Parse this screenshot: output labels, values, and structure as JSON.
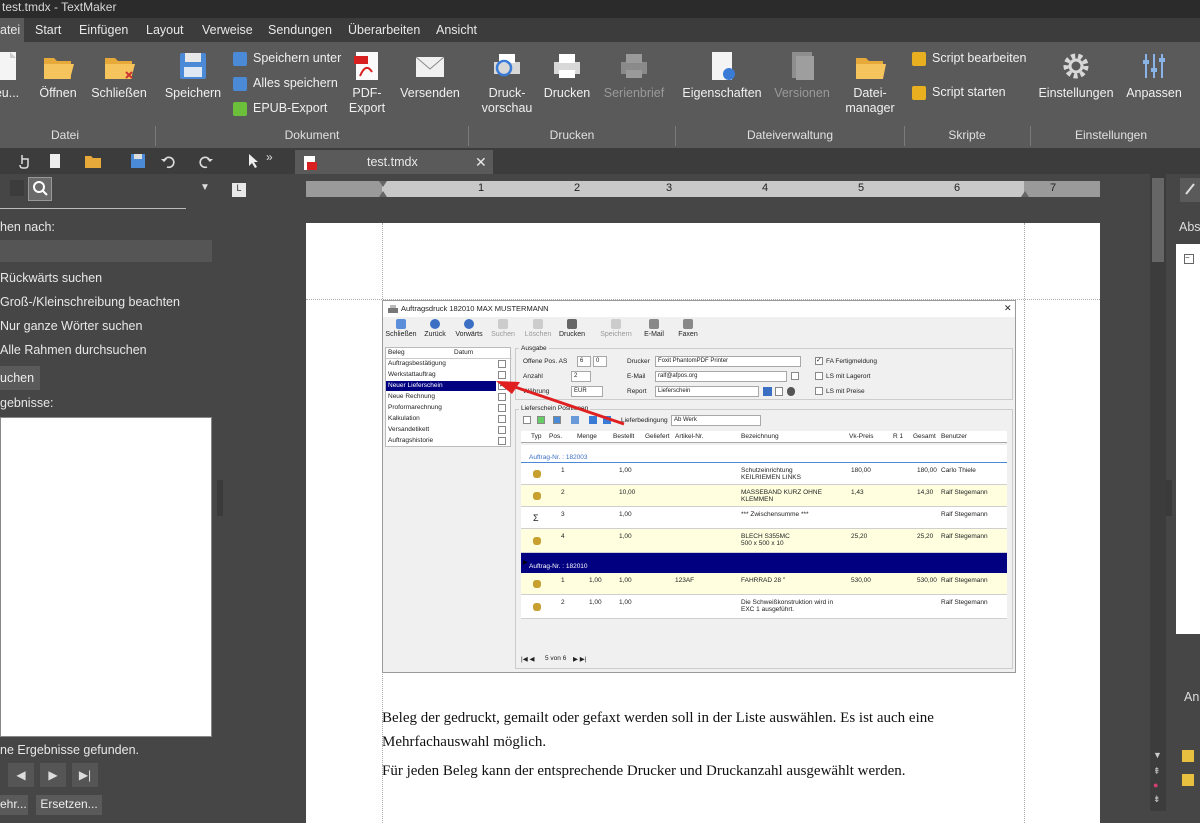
{
  "window": {
    "title": "test.tmdx - TextMaker"
  },
  "menu": {
    "tabs": [
      "atei",
      "Start",
      "Einfügen",
      "Layout",
      "Verweise",
      "Sendungen",
      "Überarbeiten",
      "Ansicht"
    ],
    "active": "atei"
  },
  "ribbon": {
    "buttons": {
      "neu": "eu...",
      "oeffnen": "Öffnen",
      "schliessen": "Schließen",
      "speichern": "Speichern",
      "speichern_unter": "Speichern unter",
      "alles_speichern": "Alles speichern",
      "epub": "EPUB-Export",
      "pdf_line1": "PDF-",
      "pdf_line2": "Export",
      "versenden": "Versenden",
      "druckvorschau_line1": "Druck-",
      "druckvorschau_line2": "vorschau",
      "drucken": "Drucken",
      "serienbrief": "Serienbrief",
      "eigenschaften": "Eigenschaften",
      "versionen": "Versionen",
      "dateimanager_line1": "Datei-",
      "dateimanager_line2": "manager",
      "script_bearbeiten": "Script bearbeiten",
      "script_starten": "Script starten",
      "einstellungen": "Einstellungen",
      "anpassen": "Anpassen"
    },
    "groups": {
      "datei": "Datei",
      "dokument": "Dokument",
      "drucken": "Drucken",
      "dateiverwaltung": "Dateiverwaltung",
      "skripte": "Skripte",
      "einstellungen": "Einstellungen"
    }
  },
  "doc_tab": {
    "label": "test.tmdx"
  },
  "search_panel": {
    "search_for": "hen nach:",
    "options": [
      "Rückwärts suchen",
      "Groß-/Kleinschreibung beachten",
      "Nur ganze Wörter suchen",
      "Alle Rahmen durchsuchen"
    ],
    "search_button": "uchen",
    "results_label": "gebnisse:",
    "no_results": "ne Ergebnisse gefunden.",
    "more_button": "ehr...",
    "replace_button": "Ersetzen..."
  },
  "right_panel": {
    "label1": "Abs",
    "label2": "An"
  },
  "ruler": {
    "numbers": [
      "1",
      "2",
      "3",
      "4",
      "5",
      "6",
      "7"
    ]
  },
  "document": {
    "para1_line1": "Beleg der gedruckt, gemailt oder gefaxt werden soll in der Liste auswählen. Es ist auch eine",
    "para1_line2": "Mehrfachauswahl möglich.",
    "para2": "Für jeden Beleg kann der entsprechende Drucker und Druckanzahl ausgewählt werden."
  },
  "embedded": {
    "title": "Auftragsdruck 182010 MAX MUSTERMANN",
    "toolbar": [
      "Schließen",
      "Zurück",
      "Vorwärts",
      "Suchen",
      "Löschen",
      "Drucken",
      "Speichern",
      "E-Mail",
      "Faxen"
    ],
    "list_headers": [
      "Beleg",
      "Datum"
    ],
    "list_items": [
      "Auftragsbestätigung",
      "Werkstattauftrag",
      "Neuer Lieferschein",
      "Neue Rechnung",
      "Proformarechnung",
      "Kalkulation",
      "Versandetikett",
      "Auftragshistorie"
    ],
    "ausgabe_label": "Ausgabe",
    "offene_pos_label": "Offene Pos. AS",
    "offene_pos_val1": "6",
    "offene_pos_val2": "0",
    "anzahl_label": "Anzahl",
    "anzahl_val": "2",
    "waehrung_label": "Währung",
    "waehrung_val": "EUR",
    "drucker_label": "Drucker",
    "drucker_val": "Foxit PhantomPDF Printer",
    "email_label": "E-Mail",
    "email_val": "ralf@afpos.org",
    "report_label": "Report",
    "report_val": "Lieferschein",
    "fa_label": "FA Fertigmeldung",
    "ls_lager_label": "LS mit Lagerort",
    "ls_preise_label": "LS mit Preise",
    "positionen_label": "Lieferschein Positionen",
    "lieferbedingung_label": "Lieferbedingung",
    "lieferbedingung_val": "Ab Werk",
    "table_headers": [
      "Typ",
      "Pos.",
      "Menge",
      "Bestellt",
      "Geliefert",
      "Artikel-Nr.",
      "Bezeichnung",
      "Vk-Preis",
      "R 1",
      "Gesamt",
      "Benutzer"
    ],
    "group1": "Auftrag-Nr. : 182003",
    "group2": "Auftrag-Nr. : 182010",
    "rows1": [
      {
        "pos": "1",
        "menge": "",
        "bestellt": "1,00",
        "artikel": "",
        "bez1": "Schutzeinrichtung",
        "bez2": "KEILRIEMEN LINKS",
        "vk": "180,00",
        "gesamt": "180,00",
        "user": "Carlo Thiele"
      },
      {
        "pos": "2",
        "menge": "",
        "bestellt": "10,00",
        "artikel": "",
        "bez1": "MASSEBAND KURZ OHNE",
        "bez2": "KLEMMEN",
        "vk": "1,43",
        "gesamt": "14,30",
        "user": "Ralf Stegemann"
      },
      {
        "pos": "3",
        "menge": "",
        "bestellt": "1,00",
        "artikel": "",
        "bez1": "*** Zwischensumme ***",
        "bez2": "",
        "vk": "",
        "gesamt": "",
        "user": "Ralf Stegemann"
      },
      {
        "pos": "4",
        "menge": "",
        "bestellt": "1,00",
        "artikel": "",
        "bez1": "BLECH  S355MC",
        "bez2": "500 x 500 x 10",
        "vk": "25,20",
        "gesamt": "25,20",
        "user": "Ralf Stegemann"
      }
    ],
    "rows2": [
      {
        "pos": "1",
        "menge": "1,00",
        "bestellt": "1,00",
        "artikel": "123AF",
        "bez1": "FAHRRAD 28 \"",
        "bez2": "",
        "vk": "530,00",
        "gesamt": "530,00",
        "user": "Ralf Stegemann"
      },
      {
        "pos": "2",
        "menge": "1,00",
        "bestellt": "1,00",
        "artikel": "",
        "bez1": "Die Schweißkonstruktion wird in",
        "bez2": "EXC 1 ausgeführt.",
        "vk": "",
        "gesamt": "",
        "user": "Ralf Stegemann"
      }
    ],
    "pager": "5 von 6"
  },
  "colors": {
    "accent_red": "#e02020",
    "highlight_navy": "#000080",
    "row_yellow": "#ffffe0"
  }
}
